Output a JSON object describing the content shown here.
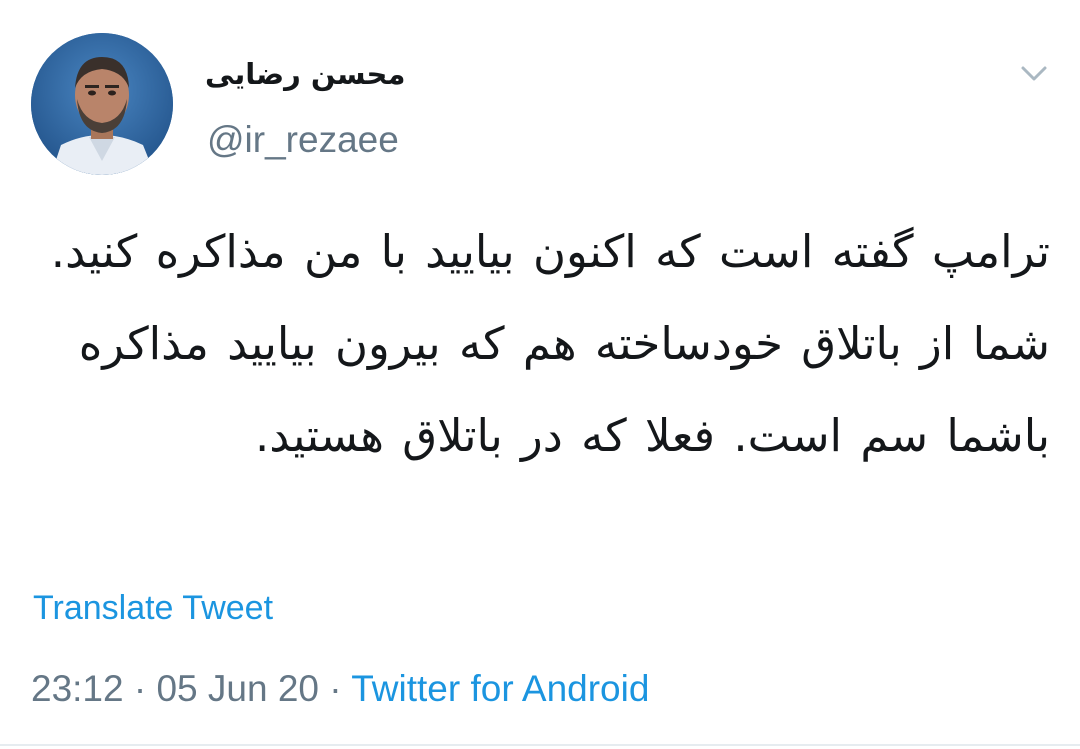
{
  "user": {
    "display_name": "محسن رضایی",
    "handle": "@ir_rezaee",
    "avatar_icon": "profile-photo"
  },
  "tweet": {
    "text": "ترامپ گفته است که اکنون بیایید با من مذاکره کنید. شما از باتلاق خودساخته هم که بیرون بیایید مذاکره باشما سم است. فعلا که در باتلاق هستید.",
    "translate_label": "Translate Tweet",
    "time": "23:12",
    "separator": "·",
    "date": "05 Jun 20",
    "source": "Twitter for Android"
  },
  "menu": {
    "caret_icon": "chevron-down-icon"
  },
  "colors": {
    "link": "#1b95e0",
    "secondary_text": "#657786",
    "primary_text": "#14171a",
    "divider": "#e6ecf0"
  }
}
